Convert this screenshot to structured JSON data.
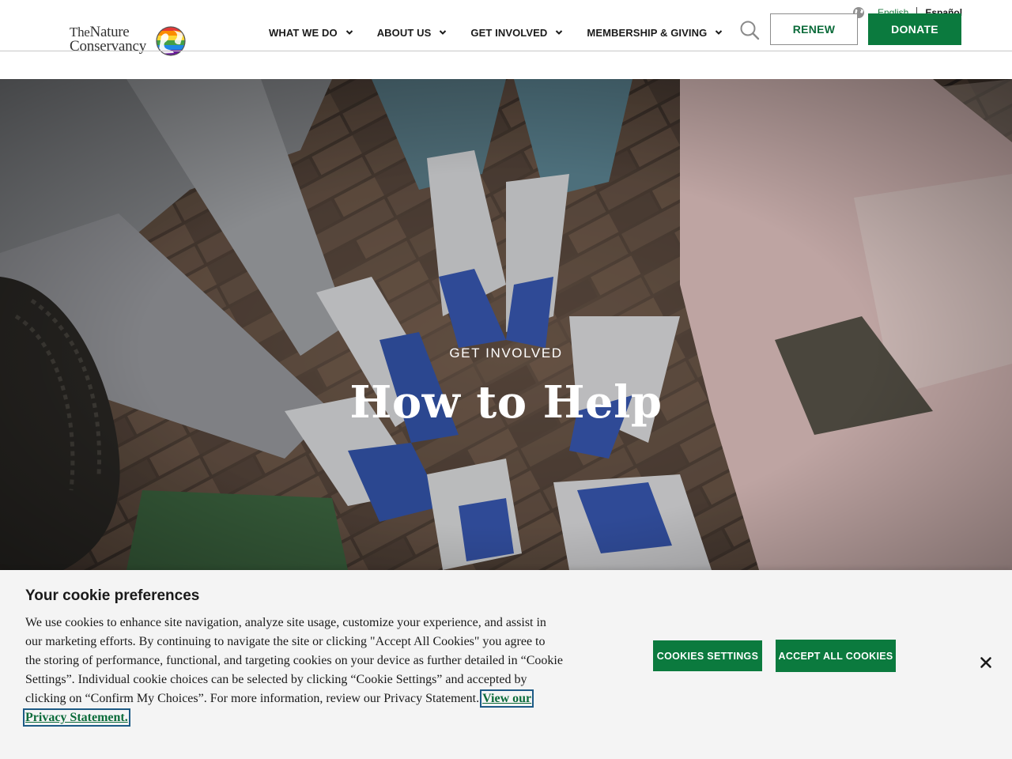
{
  "header": {
    "logo": {
      "line1_prefix": "The",
      "line1_main": "Nature",
      "line2": "Conservancy"
    },
    "nav": [
      {
        "label": "WHAT WE DO"
      },
      {
        "label": "ABOUT US"
      },
      {
        "label": "GET INVOLVED"
      },
      {
        "label": "MEMBERSHIP & GIVING"
      }
    ],
    "language": {
      "current": "English",
      "alternate": "Español"
    },
    "renew_label": "RENEW",
    "donate_label": "DONATE",
    "icons": [
      "globe-icon",
      "search-icon",
      "chevron-down-icon"
    ]
  },
  "hero": {
    "eyebrow": "GET INVOLVED",
    "title": "How to Help"
  },
  "cookie_banner": {
    "title": "Your cookie preferences",
    "body": "We use cookies to enhance site navigation, analyze site usage, customize your experience, and assist in our marketing efforts. By continuing to navigate the site or clicking \"Accept All Cookies\" you agree to the storing of performance, functional, and targeting cookies on your device as further detailed in “Cookie Settings”. Individual cookie choices can be selected by clicking “Cookie Settings” and accepted by clicking on “Confirm My Choices”. For more information, review our Privacy Statement. ",
    "privacy_link": "View our Privacy Statement.",
    "settings_label": "COOKIES SETTINGS",
    "accept_label": "ACCEPT ALL COOKIES",
    "close_icon": "close-icon"
  },
  "colors": {
    "brand_green": "#0b7a3e",
    "link_green": "#0b6b3a",
    "banner_bg": "#f4f4f4"
  }
}
